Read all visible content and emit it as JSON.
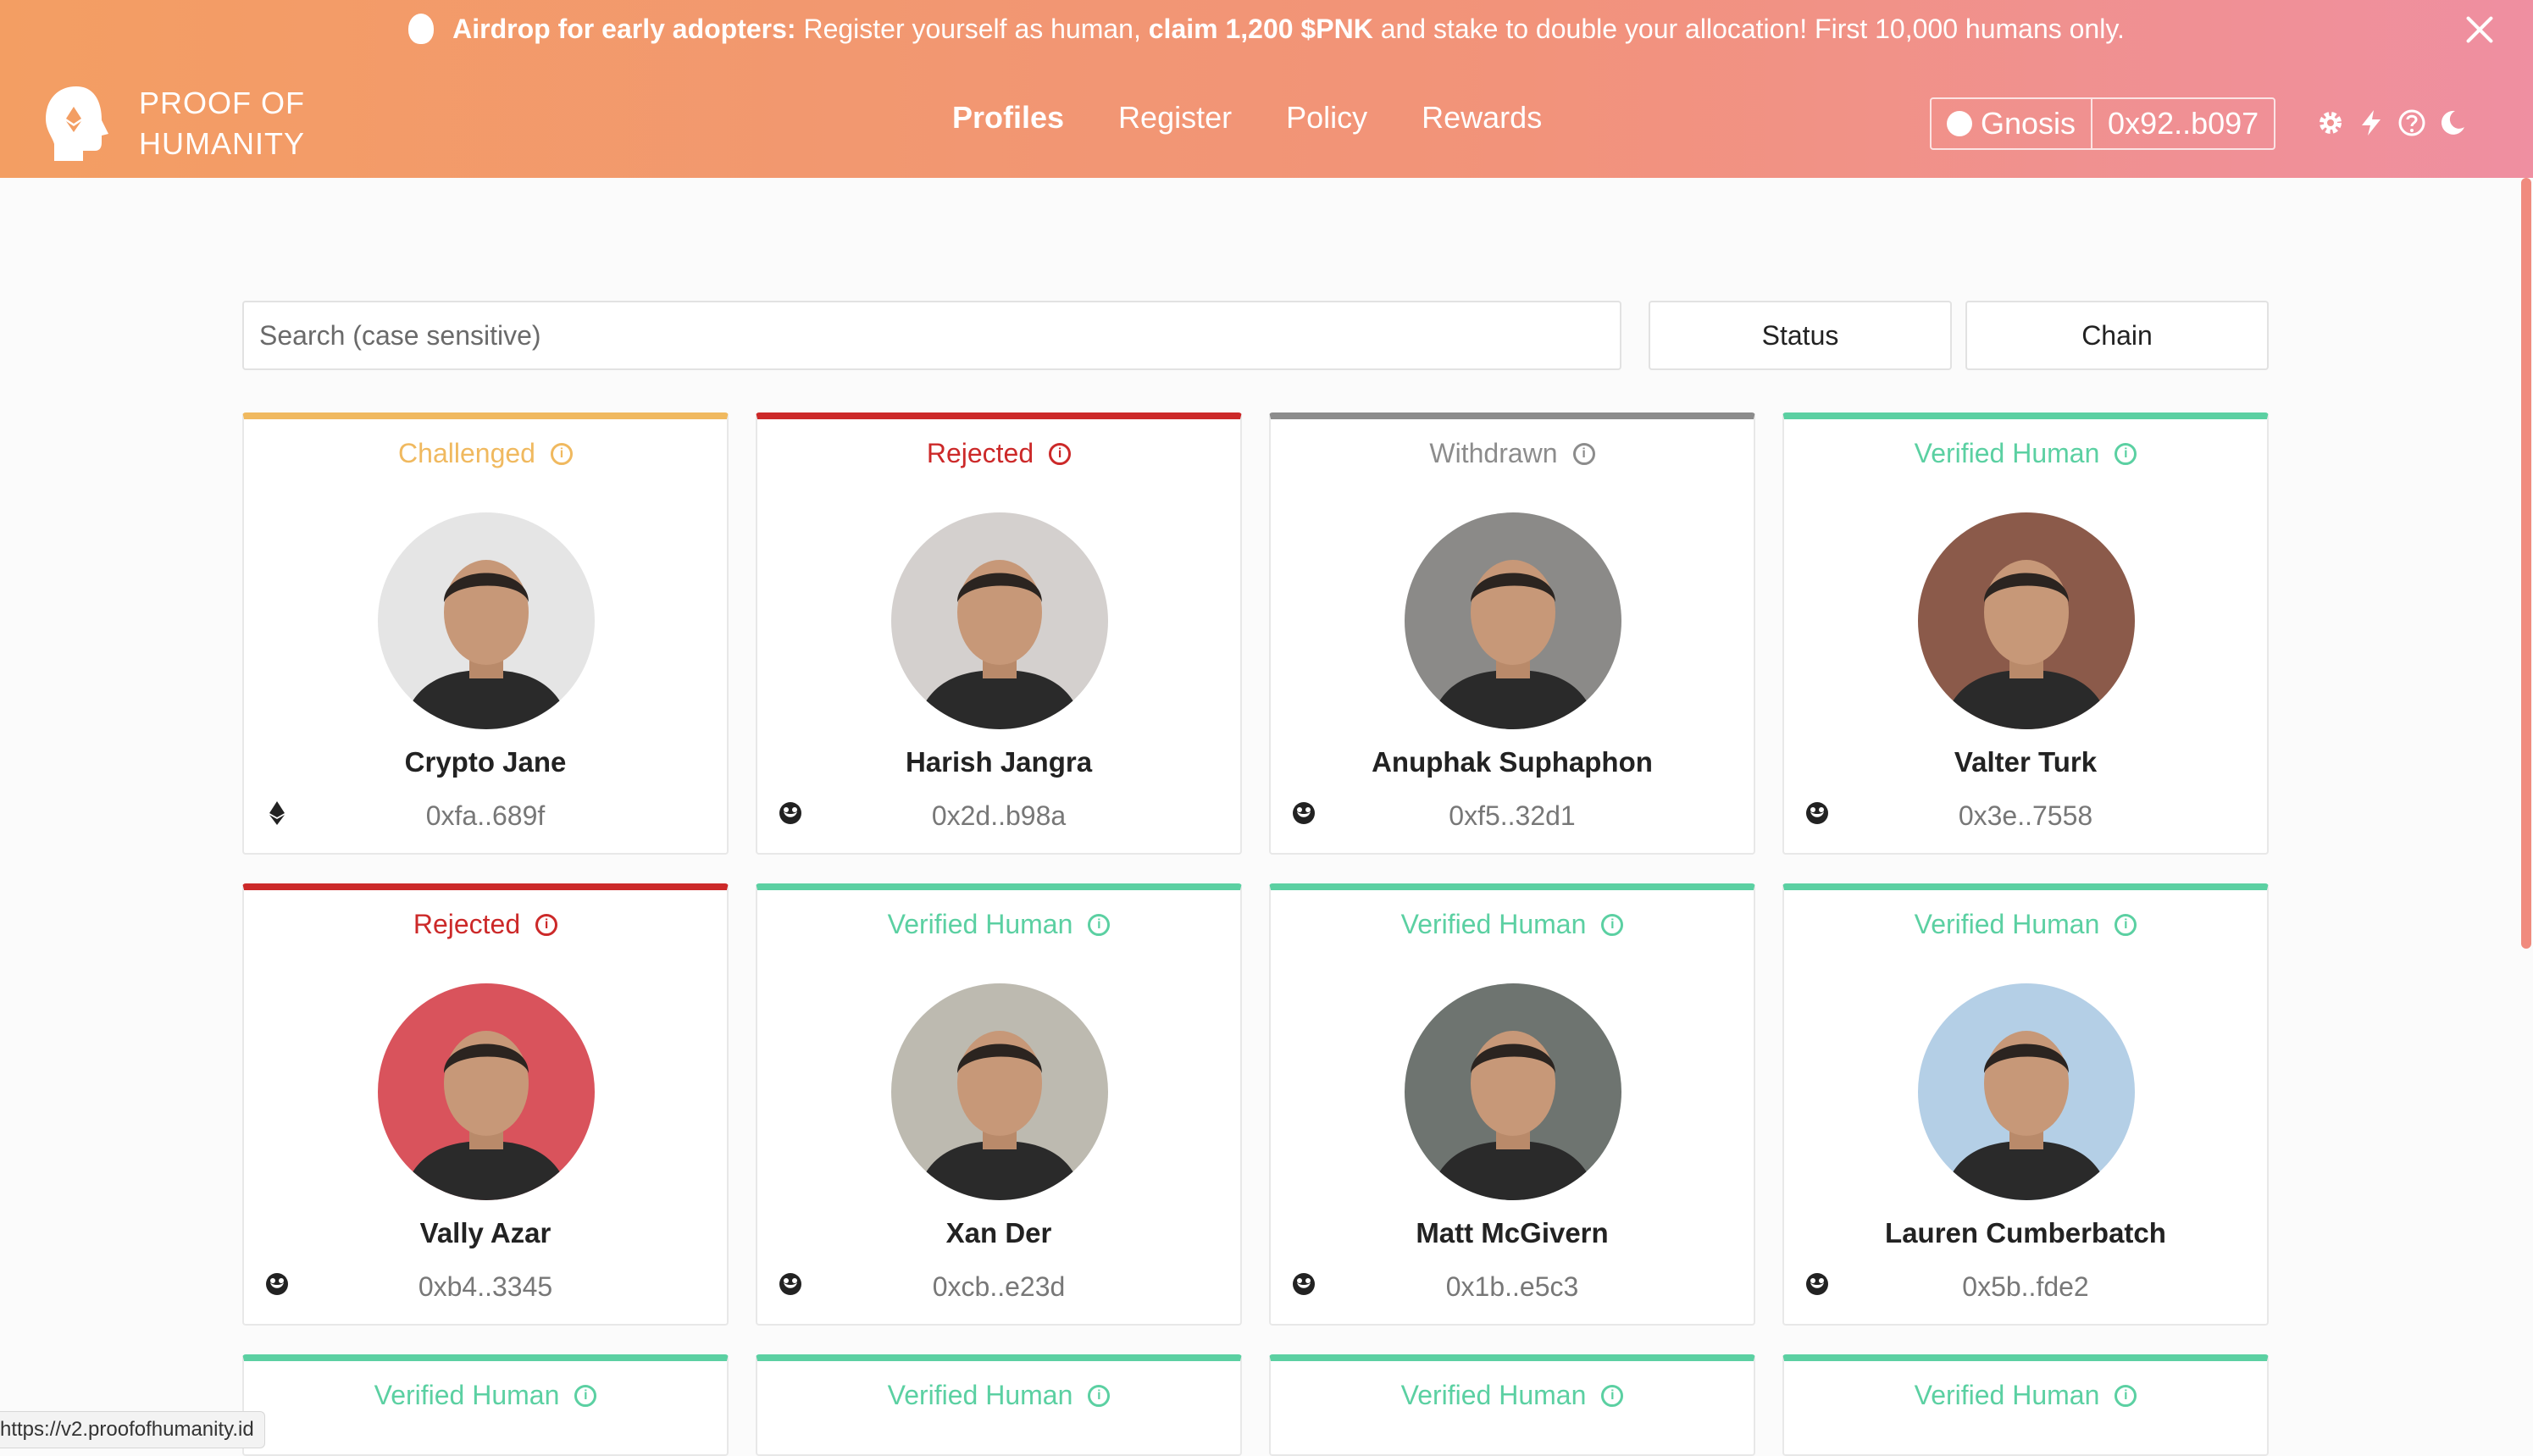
{
  "banner": {
    "bold_lead": "Airdrop for early adopters:",
    "text_1": " Register yourself as human, ",
    "bold_claim": "claim 1,200 $PNK",
    "text_2": " and stake to double your allocation! First 10,000 humans only."
  },
  "logo": {
    "line1": "PROOF OF",
    "line2": "HUMANITY"
  },
  "nav": {
    "profiles": "Profiles",
    "register": "Register",
    "policy": "Policy",
    "rewards": "Rewards"
  },
  "account": {
    "chain": "Gnosis",
    "address": "0x92..b097"
  },
  "tools": [
    "settings-icon",
    "lightning-icon",
    "help-icon",
    "dark-mode-icon"
  ],
  "search": {
    "placeholder": "Search (case sensitive)",
    "value": ""
  },
  "filters": {
    "status": "Status",
    "chain": "Chain"
  },
  "status_colors": {
    "Challenged": "#f0b95f",
    "Rejected": "#cc2929",
    "Withdrawn": "#8c8c8c",
    "Verified Human": "#5bd0a2"
  },
  "profiles": [
    {
      "status": "Challenged",
      "name": "Crypto Jane",
      "address": "0xfa..689f",
      "chain": "ethereum",
      "photo_bg": "#e5e5e5"
    },
    {
      "status": "Rejected",
      "name": "Harish Jangra",
      "address": "0x2d..b98a",
      "chain": "gnosis",
      "photo_bg": "#d4d0ce"
    },
    {
      "status": "Withdrawn",
      "name": "Anuphak Suphaphon",
      "address": "0xf5..32d1",
      "chain": "gnosis",
      "photo_bg": "#8b8a88"
    },
    {
      "status": "Verified Human",
      "name": "Valter Turk",
      "address": "0x3e..7558",
      "chain": "gnosis",
      "photo_bg": "#8b5a4a"
    },
    {
      "status": "Rejected",
      "name": "Vally Azar",
      "address": "0xb4..3345",
      "chain": "gnosis",
      "photo_bg": "#d9535c"
    },
    {
      "status": "Verified Human",
      "name": "Xan Der",
      "address": "0xcb..e23d",
      "chain": "gnosis",
      "photo_bg": "#bdbab0"
    },
    {
      "status": "Verified Human",
      "name": "Matt McGivern",
      "address": "0x1b..e5c3",
      "chain": "gnosis",
      "photo_bg": "#6e7470"
    },
    {
      "status": "Verified Human",
      "name": "Lauren Cumberbatch",
      "address": "0x5b..fde2",
      "chain": "gnosis",
      "photo_bg": "#b4cfe6"
    },
    {
      "status": "Verified Human"
    },
    {
      "status": "Verified Human"
    },
    {
      "status": "Verified Human"
    },
    {
      "status": "Verified Human"
    }
  ],
  "hover_url": "https://v2.proofofhumanity.id"
}
